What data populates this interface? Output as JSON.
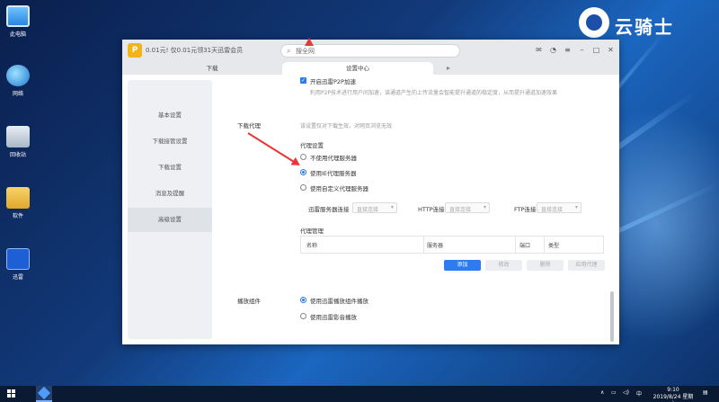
{
  "desktop": {
    "icons": [
      {
        "label": "此电脑",
        "icon": "computer-icon"
      },
      {
        "label": "网络",
        "icon": "network-icon"
      },
      {
        "label": "回收站",
        "icon": "recycle-bin-icon"
      },
      {
        "label": "软件",
        "icon": "folder-icon"
      },
      {
        "label": "迅雷",
        "icon": "thunder-icon"
      }
    ],
    "logo_text": "云骑士"
  },
  "window": {
    "promo_text": "0.01元! 仅0.01元领31天迅雷会员",
    "search": {
      "placeholder": "搜全网"
    },
    "tabs": [
      {
        "label": "下载"
      },
      {
        "label": "设置中心"
      }
    ],
    "sidebar": {
      "items": [
        {
          "label": "基本设置"
        },
        {
          "label": "下载接管设置"
        },
        {
          "label": "下载设置"
        },
        {
          "label": "消息及提醒"
        },
        {
          "label": "高级设置"
        }
      ],
      "active_index": 4
    },
    "p2p": {
      "checkbox_label": "开启迅雷P2P加速",
      "description": "利用P2P技术进行用户间加速，该通道产生的上传流量会智能提升通道的稳定度，从而提升通道加速效果"
    },
    "proxy": {
      "section_label": "下载代理",
      "hint": "该设置仅对下载生效，对网页浏览无效",
      "settings_title": "代理设置",
      "options": [
        {
          "label": "不使用代理服务器"
        },
        {
          "label": "使用IE代理服务器"
        },
        {
          "label": "使用自定义代理服务器"
        }
      ],
      "selected_index": 1,
      "connections": [
        {
          "label": "迅雷服务器连接",
          "value": "直接连接"
        },
        {
          "label": "HTTP连接",
          "value": "直接连接"
        },
        {
          "label": "FTP连接",
          "value": "直接连接"
        }
      ],
      "manage_title": "代理管理",
      "table_headers": [
        "名称",
        "服务器",
        "端口",
        "类型"
      ],
      "buttons": {
        "add": "添加",
        "edit": "修改",
        "delete": "删除",
        "apply": "应用代理"
      }
    },
    "player": {
      "section_label": "播放组件",
      "options": [
        {
          "label": "使用迅雷播放组件播放"
        },
        {
          "label": "使用迅雷影音播放"
        }
      ],
      "selected_index": 0
    }
  },
  "taskbar": {
    "time": "9:10",
    "date": "2019/8/24 星期六",
    "ime": "中"
  },
  "colors": {
    "accent": "#2d7bf0",
    "annotation": "#e83737",
    "vip": "#f2b418"
  }
}
